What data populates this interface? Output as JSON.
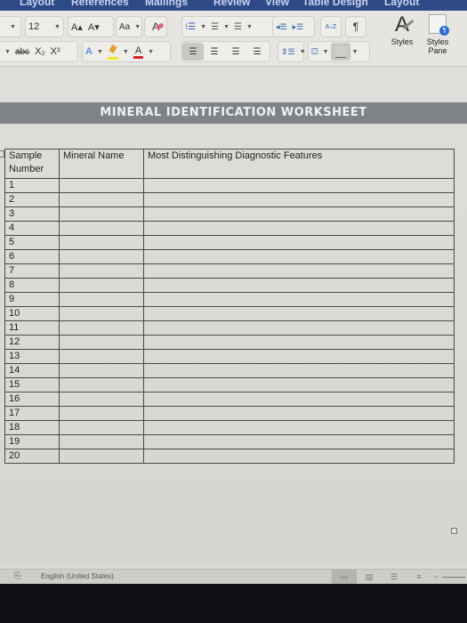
{
  "menu_tabs": [
    "Layout",
    "References",
    "Mailings",
    "Review",
    "View",
    "Table Design",
    "Layout"
  ],
  "ribbon": {
    "font_size": "12",
    "increase_font_label": "A▴",
    "decrease_font_label": "A▾",
    "change_case_label": "Aa",
    "strikethrough_label": "abc",
    "subscript_label": "X₂",
    "superscript_label": "X²",
    "text_effects_label": "A",
    "font_color_label": "A",
    "sort_label": "A↓Z",
    "pilcrow_label": "¶",
    "styles_label": "Styles",
    "styles_pane_label": "Styles Pane",
    "highlight_color": "#f0e52a",
    "font_color": "#d9232f"
  },
  "document": {
    "title": "MINERAL IDENTIFICATION WORKSHEET",
    "table": {
      "headers": [
        "Sample Number",
        "Mineral Name",
        "Most Distinguishing Diagnostic Features"
      ],
      "rows": [
        {
          "sample": "1",
          "mineral": "",
          "features": ""
        },
        {
          "sample": "2",
          "mineral": "",
          "features": ""
        },
        {
          "sample": "3",
          "mineral": "",
          "features": ""
        },
        {
          "sample": "4",
          "mineral": "",
          "features": ""
        },
        {
          "sample": "5",
          "mineral": "",
          "features": ""
        },
        {
          "sample": "6",
          "mineral": "",
          "features": ""
        },
        {
          "sample": "7",
          "mineral": "",
          "features": ""
        },
        {
          "sample": "8",
          "mineral": "",
          "features": ""
        },
        {
          "sample": "9",
          "mineral": "",
          "features": ""
        },
        {
          "sample": "10",
          "mineral": "",
          "features": ""
        },
        {
          "sample": "11",
          "mineral": "",
          "features": ""
        },
        {
          "sample": "12",
          "mineral": "",
          "features": ""
        },
        {
          "sample": "13",
          "mineral": "",
          "features": ""
        },
        {
          "sample": "14",
          "mineral": "",
          "features": ""
        },
        {
          "sample": "15",
          "mineral": "",
          "features": ""
        },
        {
          "sample": "16",
          "mineral": "",
          "features": ""
        },
        {
          "sample": "17",
          "mineral": "",
          "features": ""
        },
        {
          "sample": "18",
          "mineral": "",
          "features": ""
        },
        {
          "sample": "19",
          "mineral": "",
          "features": ""
        },
        {
          "sample": "20",
          "mineral": "",
          "features": ""
        }
      ]
    }
  },
  "status_bar": {
    "language": "English (United States)"
  }
}
